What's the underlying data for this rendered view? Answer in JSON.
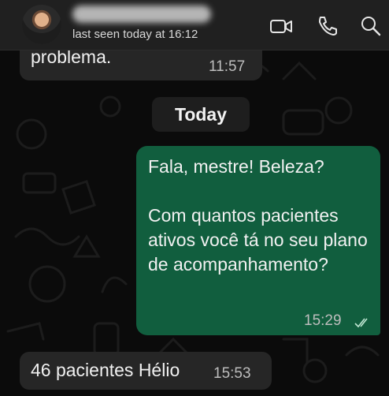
{
  "header": {
    "status": "last seen today at 16:12",
    "icons": [
      "video-camera-icon",
      "phone-icon",
      "search-icon"
    ]
  },
  "messages": [
    {
      "direction": "incoming",
      "text": "problema.",
      "time": "11:57"
    },
    {
      "direction": "outgoing",
      "text": "Fala, mestre! Beleza?\n\nCom quantos pacientes ativos você tá no seu plano de acompanhamento?",
      "time": "15:29",
      "status": "read"
    },
    {
      "direction": "incoming",
      "text": "46 pacientes Hélio",
      "time": "15:53"
    }
  ],
  "date_separator": "Today",
  "colors": {
    "background": "#0b0b0b",
    "header": "#202020",
    "incoming_bubble": "#262626",
    "outgoing_bubble": "#115e3e",
    "read_ticks": "#bfe6d2"
  }
}
